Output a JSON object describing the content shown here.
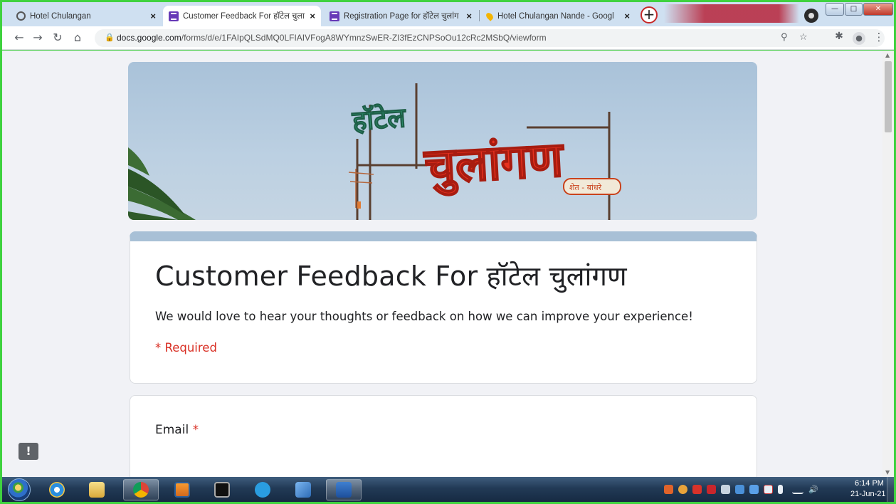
{
  "browser": {
    "tabs": [
      {
        "label": "Hotel Chulangan",
        "icon": "globe-icon",
        "active": false
      },
      {
        "label": "Customer Feedback For हॉटेल चुला",
        "icon": "google-forms-icon",
        "active": true
      },
      {
        "label": "Registration Page for हॉटेल चुलांग",
        "icon": "google-forms-icon",
        "active": false
      },
      {
        "label": "Hotel Chulangan Nande - Googl",
        "icon": "google-maps-icon",
        "active": false
      }
    ],
    "new_tab_label": "+",
    "close_glyph": "×",
    "url_host": "docs.google.com",
    "url_path": "/forms/d/e/1FAIpQLSdMQ0LFIAIVFogA8WYmnzSwER-ZI3fEzCNPSoOu12cRc2MSbQ/viewform",
    "nav_icons": [
      "back-arrow-icon",
      "forward-arrow-icon",
      "reload-icon",
      "home-icon"
    ],
    "toolbar_icons": [
      "zoom-icon",
      "star-bookmark-icon",
      "extensions-puzzle-icon",
      "profile-avatar-icon",
      "kebab-menu-icon"
    ]
  },
  "header_image": {
    "sign_top": "हॉटेल",
    "sign_main": "चुलांगण",
    "sign_small": "शेत - बांधरे"
  },
  "form": {
    "title": "Customer Feedback For हॉटेल चुलांगण",
    "description": "We would love to hear your thoughts or feedback on how we can improve your experience!",
    "required_note": "* Required",
    "questions": [
      {
        "label": "Email",
        "required_mark": "*"
      }
    ],
    "accent_color": "#a8c0d6"
  },
  "feedback_button_glyph": "!",
  "taskbar": {
    "apps": [
      "internet-explorer-icon",
      "file-explorer-icon",
      "chrome-icon",
      "media-player-icon",
      "cmd-icon",
      "skype-icon",
      "network-icon",
      "word-icon"
    ],
    "clock_time": "6:14 PM",
    "clock_date": "21-Jun-21"
  }
}
